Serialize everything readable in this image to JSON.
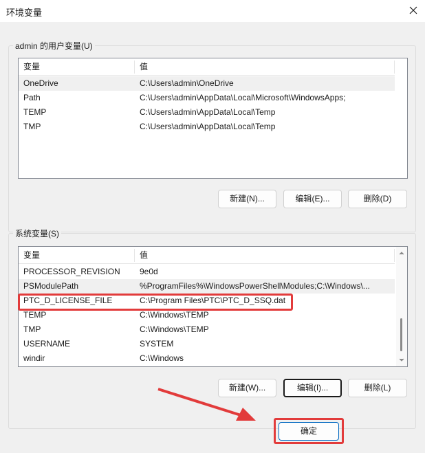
{
  "window": {
    "title": "环境变量"
  },
  "user_vars": {
    "legend": "admin 的用户变量(U)",
    "columns": [
      "变量",
      "值"
    ],
    "rows": [
      {
        "name": "OneDrive",
        "value": "C:\\Users\\admin\\OneDrive"
      },
      {
        "name": "Path",
        "value": "C:\\Users\\admin\\AppData\\Local\\Microsoft\\WindowsApps;"
      },
      {
        "name": "TEMP",
        "value": "C:\\Users\\admin\\AppData\\Local\\Temp"
      },
      {
        "name": "TMP",
        "value": "C:\\Users\\admin\\AppData\\Local\\Temp"
      }
    ],
    "buttons": {
      "new": "新建(N)...",
      "edit": "编辑(E)...",
      "delete": "删除(D)"
    }
  },
  "system_vars": {
    "legend": "系统变量(S)",
    "columns": [
      "变量",
      "值"
    ],
    "rows": [
      {
        "name": "PROCESSOR_REVISION",
        "value": "9e0d"
      },
      {
        "name": "PSModulePath",
        "value": "%ProgramFiles%\\WindowsPowerShell\\Modules;C:\\Windows\\..."
      },
      {
        "name": "PTC_D_LICENSE_FILE",
        "value": "C:\\Program Files\\PTC\\PTC_D_SSQ.dat"
      },
      {
        "name": "TEMP",
        "value": "C:\\Windows\\TEMP"
      },
      {
        "name": "TMP",
        "value": "C:\\Windows\\TEMP"
      },
      {
        "name": "USERNAME",
        "value": "SYSTEM"
      },
      {
        "name": "windir",
        "value": "C:\\Windows"
      }
    ],
    "buttons": {
      "new": "新建(W)...",
      "edit": "编辑(I)...",
      "delete": "删除(L)"
    }
  },
  "footer": {
    "ok": "确定"
  },
  "colors": {
    "annotation": "#e23b3b",
    "background": "#f0f0f0"
  },
  "icons": {
    "close": "close-icon"
  }
}
